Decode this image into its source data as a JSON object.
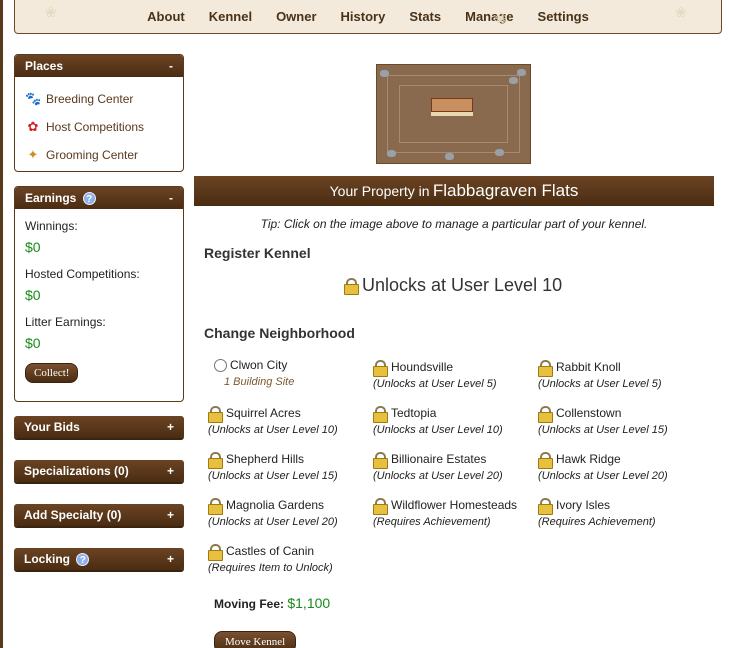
{
  "nav": [
    "About",
    "Kennel",
    "Owner",
    "History",
    "Stats",
    "Manage",
    "Settings"
  ],
  "sidebar": {
    "places": {
      "title": "Places",
      "toggle": "-",
      "items": [
        {
          "label": "Breeding Center",
          "icon": "paw-icon"
        },
        {
          "label": "Host Competitions",
          "icon": "ribbon-icon"
        },
        {
          "label": "Grooming Center",
          "icon": "wand-icon"
        }
      ]
    },
    "earnings": {
      "title": "Earnings",
      "help": "?",
      "toggle": "-",
      "winnings_label": "Winnings:",
      "winnings_value": "$0",
      "hosted_label": "Hosted Competitions:",
      "hosted_value": "$0",
      "litter_label": "Litter Earnings:",
      "litter_value": "$0",
      "collect_label": "Collect!"
    },
    "bids": {
      "title": "Your Bids",
      "toggle": "+"
    },
    "specializations": {
      "title": "Specializations (0)",
      "toggle": "+"
    },
    "add_specialty": {
      "title": "Add Specialty (0)",
      "toggle": "+"
    },
    "locking": {
      "title": "Locking",
      "help": "?",
      "toggle": "+"
    }
  },
  "main": {
    "property_prefix": "Your Property in",
    "property_name": "Flabbagraven Flats",
    "tip": "Tip: Click on the image above to manage a particular part of your kennel.",
    "register_title": "Register Kennel",
    "register_unlock": "Unlocks at User Level 10",
    "change_title": "Change Neighborhood",
    "neighborhoods": [
      {
        "name": "Clwon City",
        "req": "1 Building Site",
        "locked": false
      },
      {
        "name": "Houndsville",
        "req": "(Unlocks at User Level 5)",
        "locked": true
      },
      {
        "name": "Rabbit Knoll",
        "req": "(Unlocks at User Level 5)",
        "locked": true
      },
      {
        "name": "Squirrel Acres",
        "req": "(Unlocks at User Level 10)",
        "locked": true
      },
      {
        "name": "Tedtopia",
        "req": "(Unlocks at User Level 10)",
        "locked": true
      },
      {
        "name": "Collenstown",
        "req": "(Unlocks at User Level 15)",
        "locked": true
      },
      {
        "name": "Shepherd Hills",
        "req": "(Unlocks at User Level 15)",
        "locked": true
      },
      {
        "name": "Billionaire Estates",
        "req": "(Unlocks at User Level 20)",
        "locked": true
      },
      {
        "name": "Hawk Ridge",
        "req": "(Unlocks at User Level 20)",
        "locked": true
      },
      {
        "name": "Magnolia Gardens",
        "req": "(Unlocks at User Level 20)",
        "locked": true
      },
      {
        "name": "Wildflower Homesteads",
        "req": "(Requires Achievement)",
        "locked": true
      },
      {
        "name": "Ivory Isles",
        "req": "(Requires Achievement)",
        "locked": true
      },
      {
        "name": "Castles of Canin",
        "req": "(Requires Item to Unlock)",
        "locked": true
      }
    ],
    "moving_fee_label": "Moving Fee:",
    "moving_fee_value": "$1,100",
    "move_button": "Move Kennel"
  }
}
